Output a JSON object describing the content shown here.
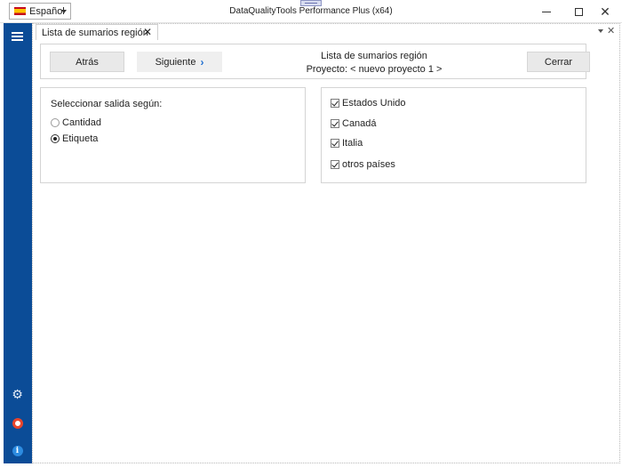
{
  "window": {
    "title": "DataQualityTools Performance Plus (x64)",
    "language": {
      "selected": "Español",
      "flag_icon": "spain-flag-icon"
    }
  },
  "sidebar": {
    "background_color": "#0b4c97",
    "items": [
      {
        "icon": "hamburger-menu-icon"
      },
      {
        "icon": "gear-icon"
      },
      {
        "icon": "lifebuoy-icon"
      },
      {
        "icon": "info-icon"
      }
    ]
  },
  "tabs": [
    {
      "label": "Lista de sumarios región",
      "active": true
    }
  ],
  "toolbar": {
    "back_label": "Atrás",
    "next_label": "Siguiente",
    "close_label": "Cerrar",
    "title": "Lista de sumarios región",
    "project": "Proyecto: < nuevo proyecto 1 >"
  },
  "output_group": {
    "label": "Seleccionar salida según:",
    "options": [
      {
        "label": "Cantidad",
        "checked": false
      },
      {
        "label": "Etiqueta",
        "checked": true
      }
    ]
  },
  "countries": [
    {
      "label": "Estados Unido",
      "checked": true
    },
    {
      "label": "Canadá",
      "checked": true
    },
    {
      "label": "Italia",
      "checked": true
    },
    {
      "label": "otros países",
      "checked": true
    }
  ]
}
